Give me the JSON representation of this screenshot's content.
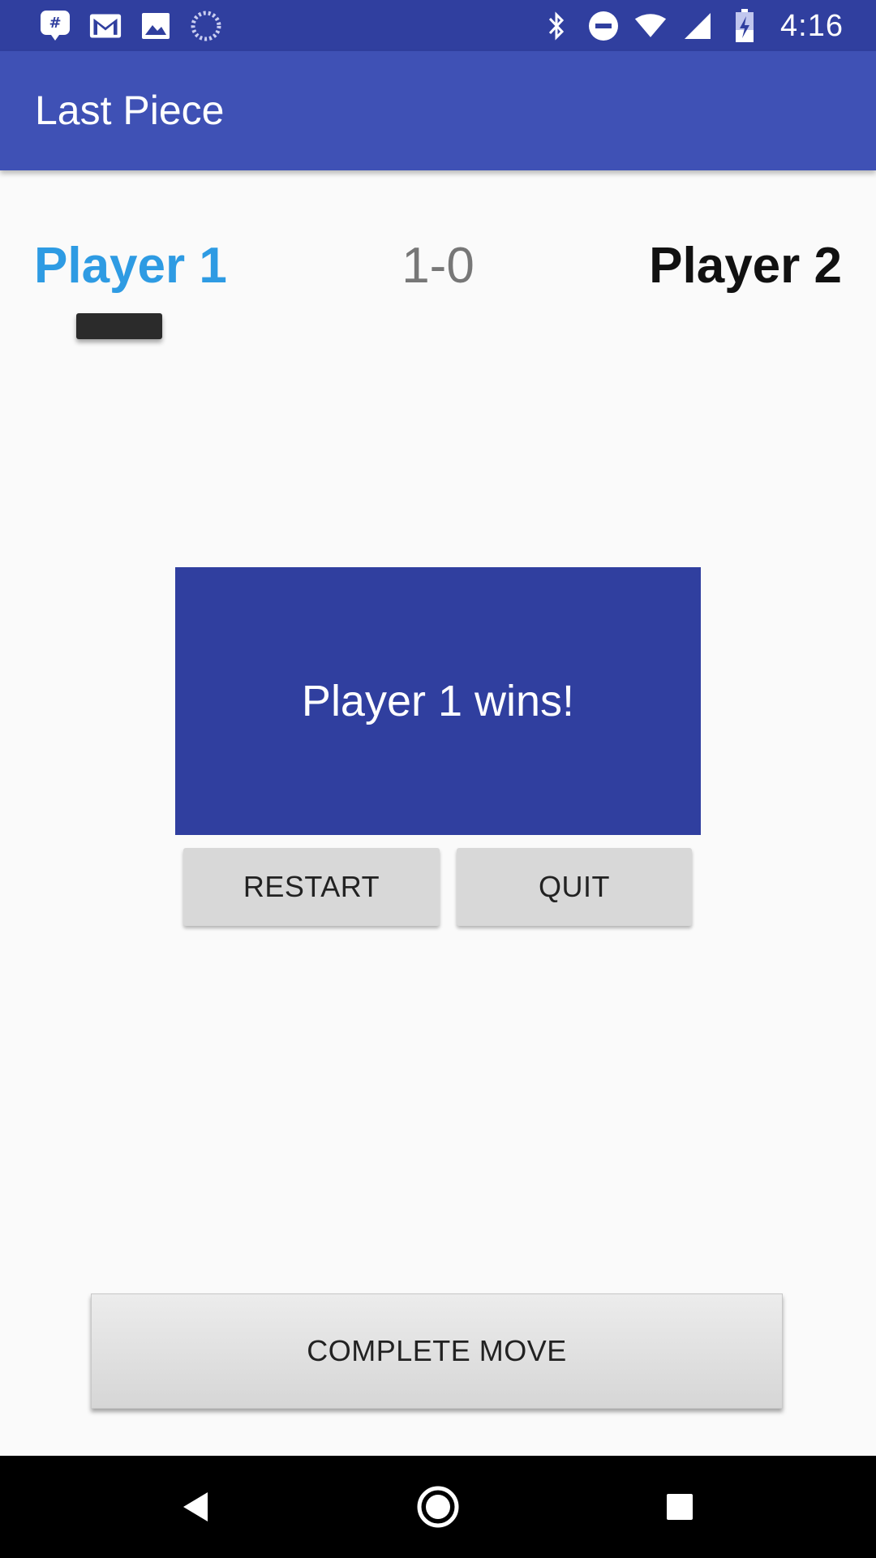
{
  "status_bar": {
    "time": "4:16",
    "left_icons": [
      "notification-app-icon",
      "gmail-icon",
      "image-icon",
      "sync-icon"
    ],
    "right_icons": [
      "bluetooth-icon",
      "do-not-disturb-icon",
      "wifi-icon",
      "signal-icon",
      "battery-charging-icon"
    ]
  },
  "app_bar": {
    "title": "Last Piece"
  },
  "game": {
    "player1": "Player 1",
    "score": "1-0",
    "player2": "Player 2"
  },
  "result": {
    "message": "Player 1 wins!",
    "restart_label": "RESTART",
    "quit_label": "QUIT"
  },
  "actions": {
    "complete_move_label": "COMPLETE MOVE"
  },
  "colors": {
    "status_bar": "#303f9f",
    "app_bar": "#3f51b5",
    "player1": "#2e9be3",
    "result_panel": "#303f9f"
  },
  "nav_bar": {
    "icons": [
      "back-icon",
      "home-icon",
      "recents-icon"
    ]
  }
}
